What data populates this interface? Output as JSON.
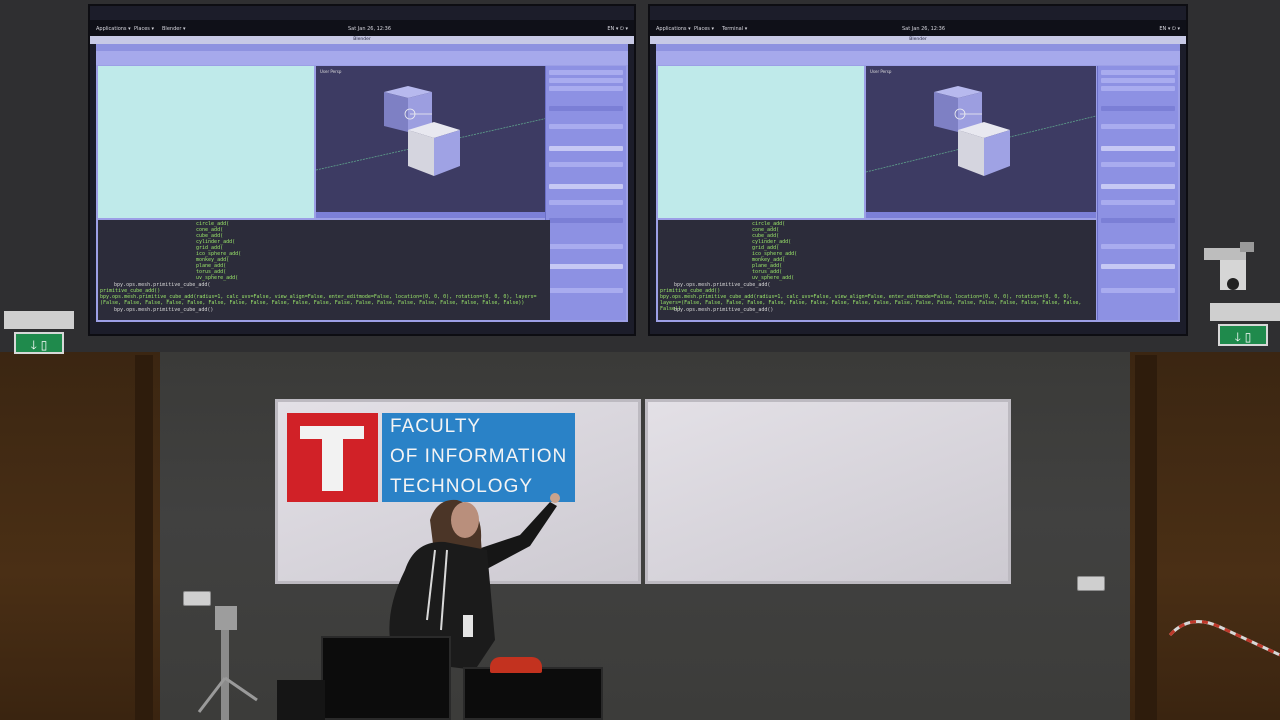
{
  "screens": [
    {
      "topbar": {
        "applications": "Applications ▾",
        "places": "Places ▾",
        "app": "Blender ▾",
        "clock": "Sat Jan 26, 12:36",
        "status": "EN ▾  ⏻ ▾"
      },
      "window_title": "Blender",
      "console_lines": [
        "circle_add(",
        "cone_add(",
        "cube_add(",
        "cylinder_add(",
        "grid_add(",
        "ico_sphere_add(",
        "monkey_add(",
        "plane_add(",
        "torus_add(",
        "uv_sphere_add("
      ],
      "console_prompt": "    bpy.ops.mesh.primitive_cube_add(",
      "console_prompt2": "primitive_cube_add()",
      "console_signature": "bpy.ops.mesh.primitive_cube_add(radius=1, calc_uvs=False, view_align=False, enter_editmode=False, location=(0, 0, 0), rotation=(0, 0, 0), layers=(False, False, False, False, False, False, False, False, False, False, False, False, False, False, False, False, False, False, False, False))",
      "console_last": "    bpy.ops.mesh.primitive_cube_add()"
    },
    {
      "topbar": {
        "applications": "Applications ▾",
        "places": "Places ▾",
        "app": "Terminal ▾",
        "clock": "Sat Jan 26, 12:36",
        "status": "EN ▾  ⏻ ▾"
      },
      "window_title": "Blender",
      "console_lines": [
        "circle_add(",
        "cone_add(",
        "cube_add(",
        "cylinder_add(",
        "grid_add(",
        "ico_sphere_add(",
        "monkey_add(",
        "plane_add(",
        "torus_add(",
        "uv_sphere_add("
      ],
      "console_prompt": "    bpy.ops.mesh.primitive_cube_add(",
      "console_prompt2": "primitive_cube_add()",
      "console_signature": "bpy.ops.mesh.primitive_cube_add(radius=1, calc_uvs=False, view_align=False, enter_editmode=False, location=(0, 0, 0), rotation=(0, 0, 0), layers=(False, False, False, False, False, False, False, False, False, False, False, False, False, False, False, False, False, False, False, False))",
      "console_last": "    bpy.ops.mesh.primitive_cube_add()"
    }
  ],
  "logo": {
    "line1": "FACULTY",
    "line2": "OF INFORMATION",
    "line3": "TECHNOLOGY",
    "red": "#d12127",
    "blue": "#2a82c7"
  },
  "exit_sign_glyph": "🡓 ▯",
  "colors": {
    "blender_ui": "#9c9fe6",
    "viewport": "#3d3b63",
    "text_editor": "#bfeaea",
    "console_text": "#9be76a",
    "wood": "#4a2f15",
    "wall": "#414140"
  }
}
